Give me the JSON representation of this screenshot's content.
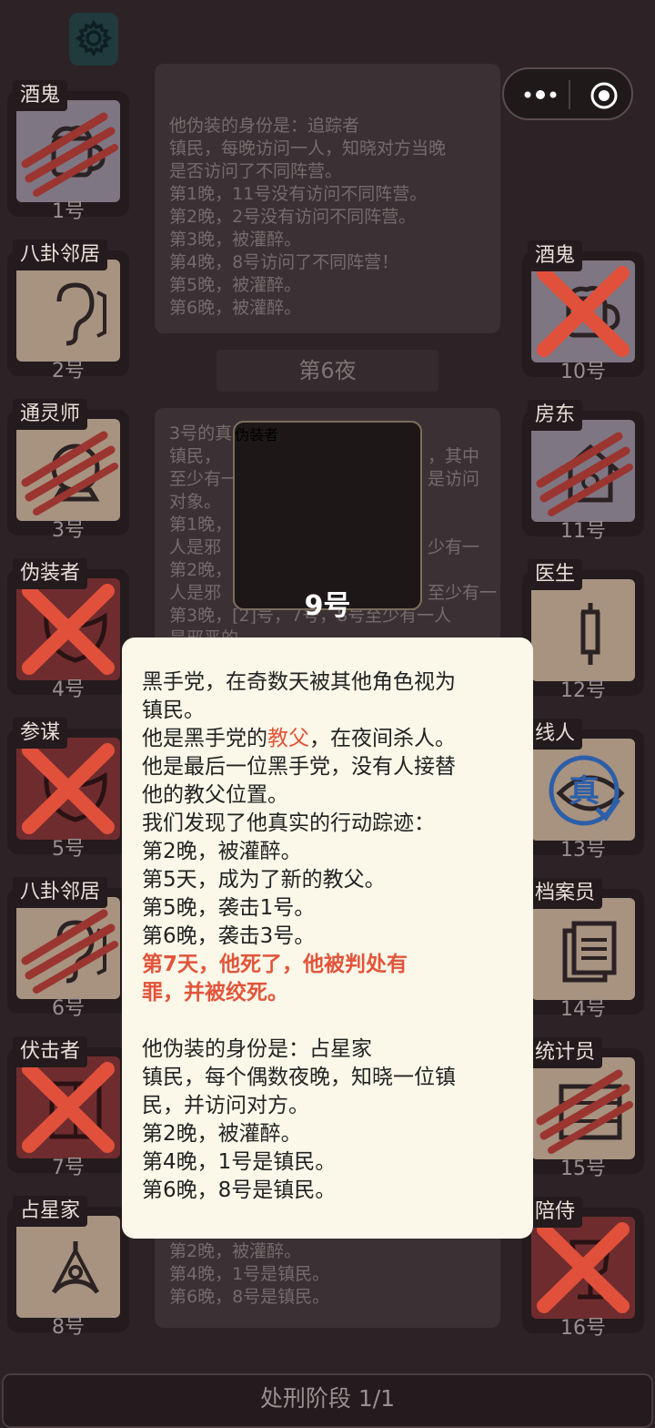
{
  "top_log": {
    "lines": [
      "他伪装的身份是：追踪者",
      "镇民，每晚访问一人，知晓对方当晚",
      "是否访问了不同阵营。",
      "第1晚，11号没有访问不同阵营。",
      "第2晚，2号没有访问不同阵营。",
      "第3晚，被灌醉。",
      "第4晚，8号访问了不同阵营！",
      "第5晚，被灌醉。",
      "第6晚，被灌醉。"
    ]
  },
  "night_label": "第6夜",
  "mid_log": {
    "lines": [
      "3号的真",
      "镇民，",
      "至少有一",
      "对象。",
      "第1晚，",
      "人是邪",
      "第2晚，",
      "人是邪",
      "第3晚，[2]号，7号，8号至少有一人",
      "是邪恶的。"
    ],
    "right_lines": [
      "，其中",
      "是访问",
      "少有一",
      "至少有一"
    ]
  },
  "lower_log": {
    "lines": [
      "第2晚，被灌醉。",
      "第4晚，1号是镇民。",
      "第6晚，8号是镇民。"
    ]
  },
  "left_cards": [
    {
      "label": "酒鬼",
      "num": "1号",
      "style": "ghost",
      "icon": "mug-icon",
      "mark": "claw"
    },
    {
      "label": "八卦邻居",
      "num": "2号",
      "style": "town",
      "icon": "ear-icon",
      "mark": "none"
    },
    {
      "label": "通灵师",
      "num": "3号",
      "style": "town",
      "icon": "crystal-ball-icon",
      "mark": "claw"
    },
    {
      "label": "伪装者",
      "num": "4号",
      "style": "evil",
      "icon": "mask-icon",
      "mark": "x"
    },
    {
      "label": "参谋",
      "num": "5号",
      "style": "evil",
      "icon": "mask-icon",
      "mark": "x"
    },
    {
      "label": "八卦邻居",
      "num": "6号",
      "style": "town",
      "icon": "ear-icon",
      "mark": "claw"
    },
    {
      "label": "伏击者",
      "num": "7号",
      "style": "evil",
      "icon": "book-icon",
      "mark": "x"
    },
    {
      "label": "占星家",
      "num": "8号",
      "style": "town",
      "icon": "sextant-icon",
      "mark": "none"
    }
  ],
  "right_cards": [
    {
      "label": "酒鬼",
      "num": "10号",
      "style": "ghost",
      "icon": "mug-icon",
      "mark": "x"
    },
    {
      "label": "房东",
      "num": "11号",
      "style": "ghost",
      "icon": "house-icon",
      "mark": "claw"
    },
    {
      "label": "医生",
      "num": "12号",
      "style": "town",
      "icon": "syringe-icon",
      "mark": "none"
    },
    {
      "label": "线人",
      "num": "13号",
      "style": "town",
      "icon": "eye-icon",
      "mark": "none"
    },
    {
      "label": "档案员",
      "num": "14号",
      "style": "town",
      "icon": "documents-icon",
      "mark": "none"
    },
    {
      "label": "统计员",
      "num": "15号",
      "style": "town",
      "icon": "abacus-icon",
      "mark": "claw"
    },
    {
      "label": "陪侍",
      "num": "16号",
      "style": "evil",
      "icon": "wine-glass-icon",
      "mark": "x"
    }
  ],
  "center_card": {
    "label": "伪装者",
    "num": "9号",
    "icon": "mask-icon"
  },
  "stamp_text": "真",
  "popup": {
    "l1": "黑手党，在奇数天被其他角色视为",
    "l2": "镇民。",
    "l3a": "他是黑手党的",
    "l3b": "教父",
    "l3c": "，在夜间杀人。",
    "l4": "他是最后一位黑手党，没有人接替",
    "l5": "他的教父位置。",
    "l6": "我们发现了他真实的行动踪迹：",
    "l7": "第2晚，被灌醉。",
    "l8": "第5天，成为了新的教父。",
    "l9": "第5晚，袭击1号。",
    "l10": "第6晚，袭击3号。",
    "l11": "第7天，他死了，他被判处有",
    "l12": "罪，并被绞死。",
    "l13": "他伪装的身份是：占星家",
    "l14": "镇民，每个偶数夜晚，知晓一位镇",
    "l15": "民，并访问对方。",
    "l16": "第2晚，被灌醉。",
    "l17": "第4晚，1号是镇民。",
    "l18": "第6晚，8号是镇民。"
  },
  "bottom_bar": "处刑阶段 1/1",
  "colors": {
    "background": "#2d2326",
    "popup_bg": "#fbf8e9",
    "highlight": "#e2553b",
    "x_mark": "#e0503a",
    "claw": "#9b3530"
  }
}
